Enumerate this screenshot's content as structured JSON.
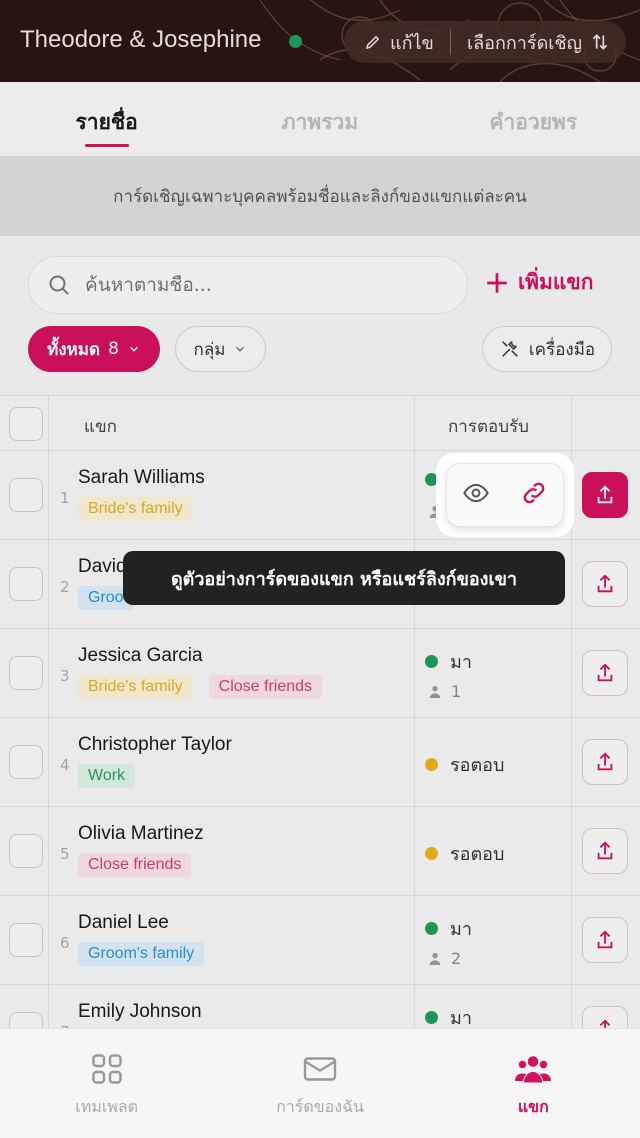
{
  "header": {
    "title": "Theodore & Josephine",
    "edit_label": "แก้ไข",
    "choose_card_label": "เลือกการ์ดเชิญ"
  },
  "tabs": [
    {
      "label": "รายชื่อ",
      "active": true
    },
    {
      "label": "ภาพรวม",
      "active": false
    },
    {
      "label": "คำอวยพร",
      "active": false
    }
  ],
  "banner": "การ์ดเชิญเฉพาะบุคคลพร้อมชื่อและลิงก์ของแขกแต่ละคน",
  "search": {
    "placeholder": "ค้นหาตามชื่อ..."
  },
  "add_guest_label": "เพิ่มแขก",
  "filters": {
    "all_label": "ทั้งหมด",
    "all_count": "8",
    "group_label": "กลุ่ม",
    "tools_label": "เครื่องมือ"
  },
  "table": {
    "col_guest": "แขก",
    "col_rsvp": "การตอบรับ",
    "rows": [
      {
        "num": "1",
        "name": "Sarah Williams",
        "tags": [
          {
            "label": "Bride's family",
            "kind": "bride"
          }
        ],
        "status": "",
        "status_color": "green",
        "people": ""
      },
      {
        "num": "2",
        "name": "David",
        "tags": [
          {
            "label": "Groo",
            "kind": "groom"
          }
        ],
        "status": "",
        "status_color": "",
        "people": ""
      },
      {
        "num": "3",
        "name": "Jessica Garcia",
        "tags": [
          {
            "label": "Bride's family",
            "kind": "bride"
          },
          {
            "label": "Close friends",
            "kind": "friends"
          }
        ],
        "status": "มา",
        "status_color": "green",
        "people": "1"
      },
      {
        "num": "4",
        "name": "Christopher Taylor",
        "tags": [
          {
            "label": "Work",
            "kind": "work"
          }
        ],
        "status": "รอตอบ",
        "status_color": "yellow",
        "people": ""
      },
      {
        "num": "5",
        "name": "Olivia Martinez",
        "tags": [
          {
            "label": "Close friends",
            "kind": "friends"
          }
        ],
        "status": "รอตอบ",
        "status_color": "yellow",
        "people": ""
      },
      {
        "num": "6",
        "name": "Daniel Lee",
        "tags": [
          {
            "label": "Groom's family",
            "kind": "groom"
          }
        ],
        "status": "มา",
        "status_color": "green",
        "people": "2"
      },
      {
        "num": "7",
        "name": "Emily Johnson",
        "tags": [],
        "status": "มา",
        "status_color": "green",
        "people": ""
      }
    ]
  },
  "tooltip": "ดูตัวอย่างการ์ดของแขก หรือแชร์ลิงก์ของเขา",
  "bottom_nav": [
    {
      "label": "เทมเพลต",
      "icon": "grid-icon",
      "active": false
    },
    {
      "label": "การ์ดของฉัน",
      "icon": "envelope-icon",
      "active": false
    },
    {
      "label": "แขก",
      "icon": "people-icon",
      "active": true
    }
  ],
  "colors": {
    "accent": "#d3115e",
    "header_bg": "#2a1512"
  }
}
